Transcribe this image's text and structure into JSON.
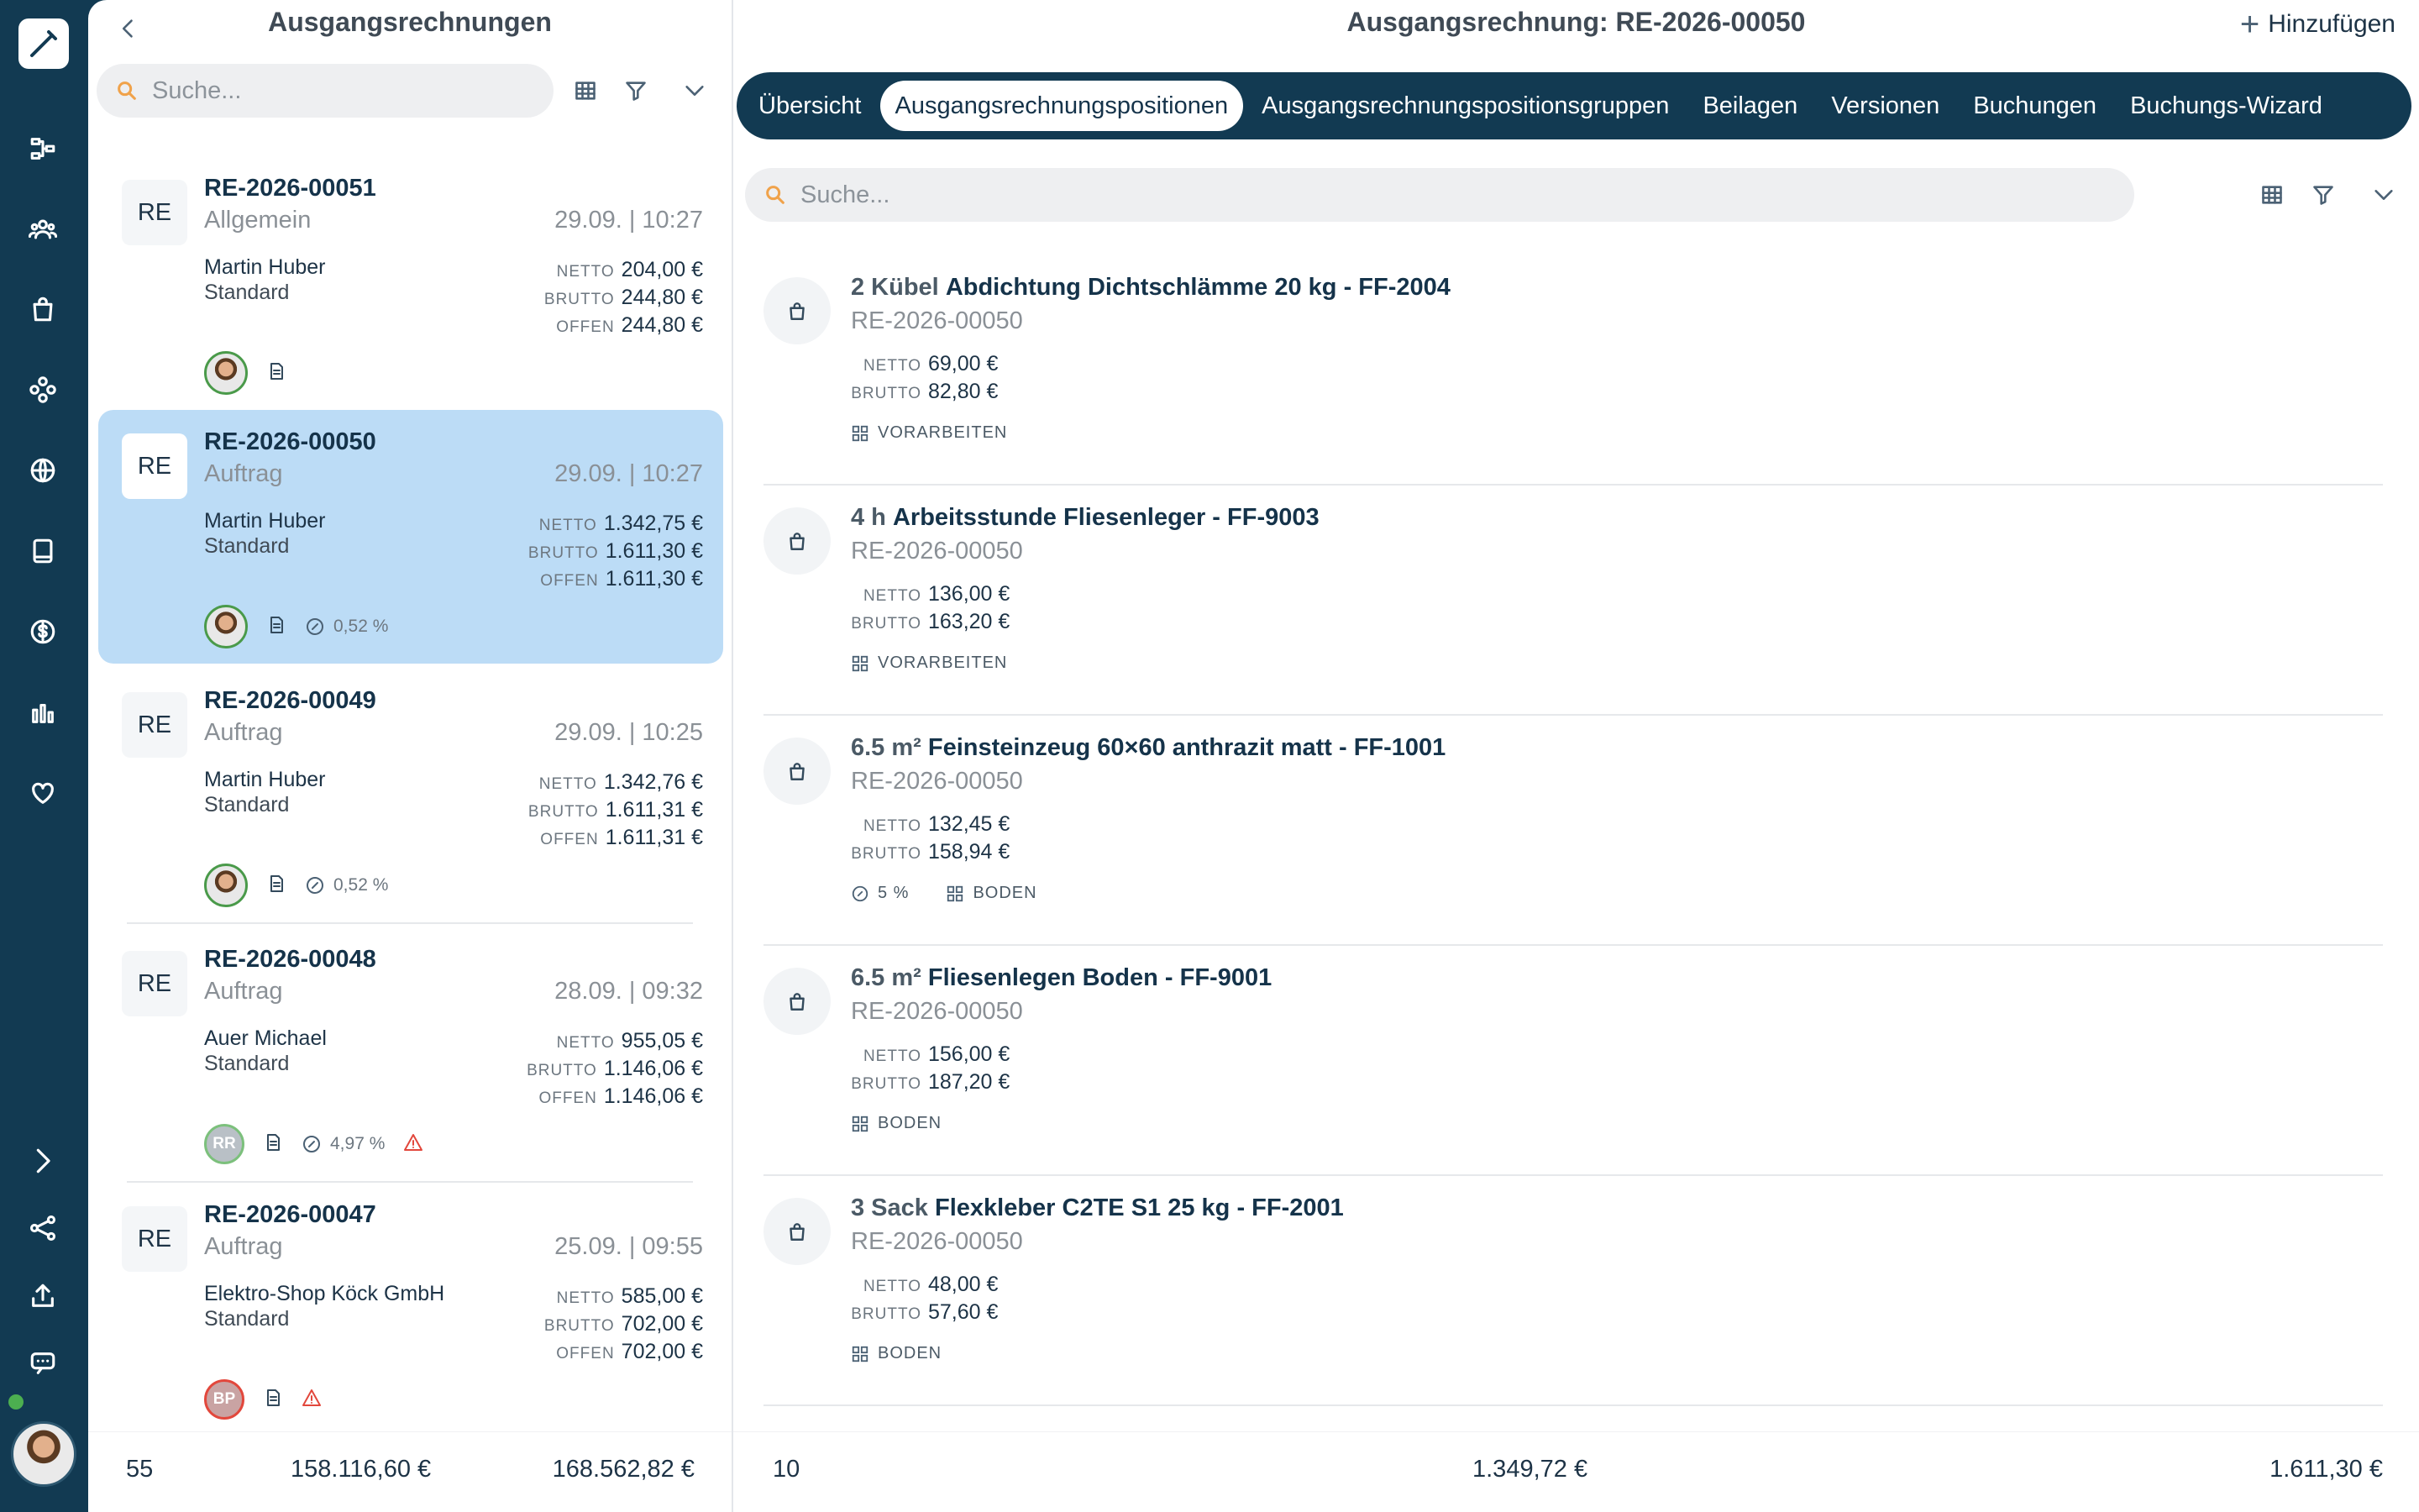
{
  "list": {
    "title": "Ausgangsrechnungen",
    "search_placeholder": "Suche...",
    "cards": [
      {
        "badge": "RE",
        "number": "RE-2026-00051",
        "type": "Allgemein",
        "date": "29.09. | 10:27",
        "customer": "Martin Huber",
        "profile": "Standard",
        "netto_label": "NETTO",
        "netto": "204,00 €",
        "brutto_label": "BRUTTO",
        "brutto": "244,80 €",
        "offen_label": "OFFEN",
        "offen": "244,80 €",
        "discount": "",
        "avatar_initials": ""
      },
      {
        "badge": "RE",
        "number": "RE-2026-00050",
        "type": "Auftrag",
        "date": "29.09. | 10:27",
        "customer": "Martin Huber",
        "profile": "Standard",
        "netto_label": "NETTO",
        "netto": "1.342,75 €",
        "brutto_label": "BRUTTO",
        "brutto": "1.611,30 €",
        "offen_label": "OFFEN",
        "offen": "1.611,30 €",
        "discount": "0,52 %",
        "avatar_initials": ""
      },
      {
        "badge": "RE",
        "number": "RE-2026-00049",
        "type": "Auftrag",
        "date": "29.09. | 10:25",
        "customer": "Martin Huber",
        "profile": "Standard",
        "netto_label": "NETTO",
        "netto": "1.342,76 €",
        "brutto_label": "BRUTTO",
        "brutto": "1.611,31 €",
        "offen_label": "OFFEN",
        "offen": "1.611,31 €",
        "discount": "0,52 %",
        "avatar_initials": ""
      },
      {
        "badge": "RE",
        "number": "RE-2026-00048",
        "type": "Auftrag",
        "date": "28.09. | 09:32",
        "customer": "Auer Michael",
        "profile": "Standard",
        "netto_label": "NETTO",
        "netto": "955,05 €",
        "brutto_label": "BRUTTO",
        "brutto": "1.146,06 €",
        "offen_label": "OFFEN",
        "offen": "1.146,06 €",
        "discount": "4,97 %",
        "avatar_initials": "RR"
      },
      {
        "badge": "RE",
        "number": "RE-2026-00047",
        "type": "Auftrag",
        "date": "25.09. | 09:55",
        "customer": "Elektro-Shop Köck GmbH",
        "profile": "Standard",
        "netto_label": "NETTO",
        "netto": "585,00 €",
        "brutto_label": "BRUTTO",
        "brutto": "702,00 €",
        "offen_label": "OFFEN",
        "offen": "702,00 €",
        "discount": "",
        "avatar_initials": "BP"
      }
    ],
    "footer": {
      "count": "55",
      "netto_total": "158.116,60 €",
      "brutto_total": "168.562,82 €"
    }
  },
  "detail": {
    "title": "Ausgangsrechnung: RE-2026-00050",
    "add_label": "Hinzufügen",
    "tabs": [
      "Übersicht",
      "Ausgangsrechnungspositionen",
      "Ausgangsrechnungspositionsgruppen",
      "Beilagen",
      "Versionen",
      "Buchungen",
      "Buchungs-Wizard"
    ],
    "search_placeholder": "Suche...",
    "positions": [
      {
        "qty": "2 Kübel",
        "name": "Abdichtung Dichtschlämme 20 kg - FF-2004",
        "ref": "RE-2026-00050",
        "netto_label": "NETTO",
        "netto": "69,00 €",
        "brutto_label": "BRUTTO",
        "brutto": "82,80 €",
        "discount": "",
        "group": "VORARBEITEN"
      },
      {
        "qty": "4 h",
        "name": "Arbeitsstunde Fliesenleger - FF-9003",
        "ref": "RE-2026-00050",
        "netto_label": "NETTO",
        "netto": "136,00 €",
        "brutto_label": "BRUTTO",
        "brutto": "163,20 €",
        "discount": "",
        "group": "VORARBEITEN"
      },
      {
        "qty": "6.5 m²",
        "name": "Feinsteinzeug 60×60 anthrazit matt - FF-1001",
        "ref": "RE-2026-00050",
        "netto_label": "NETTO",
        "netto": "132,45 €",
        "brutto_label": "BRUTTO",
        "brutto": "158,94 €",
        "discount": "5 %",
        "group": "BODEN"
      },
      {
        "qty": "6.5 m²",
        "name": "Fliesenlegen Boden - FF-9001",
        "ref": "RE-2026-00050",
        "netto_label": "NETTO",
        "netto": "156,00 €",
        "brutto_label": "BRUTTO",
        "brutto": "187,20 €",
        "discount": "",
        "group": "BODEN"
      },
      {
        "qty": "3 Sack",
        "name": "Flexkleber C2TE S1 25 kg - FF-2001",
        "ref": "RE-2026-00050",
        "netto_label": "NETTO",
        "netto": "48,00 €",
        "brutto_label": "BRUTTO",
        "brutto": "57,60 €",
        "discount": "",
        "group": "BODEN"
      }
    ],
    "footer": {
      "count": "10",
      "netto_total": "1.349,72 €",
      "brutto_total": "1.611,30 €"
    }
  },
  "colors": {
    "rail": "#123a52",
    "selected_card": "#bcdcf6",
    "search_icon": "#f0a24a",
    "warning": "#e2473c",
    "online": "#4caf50"
  }
}
